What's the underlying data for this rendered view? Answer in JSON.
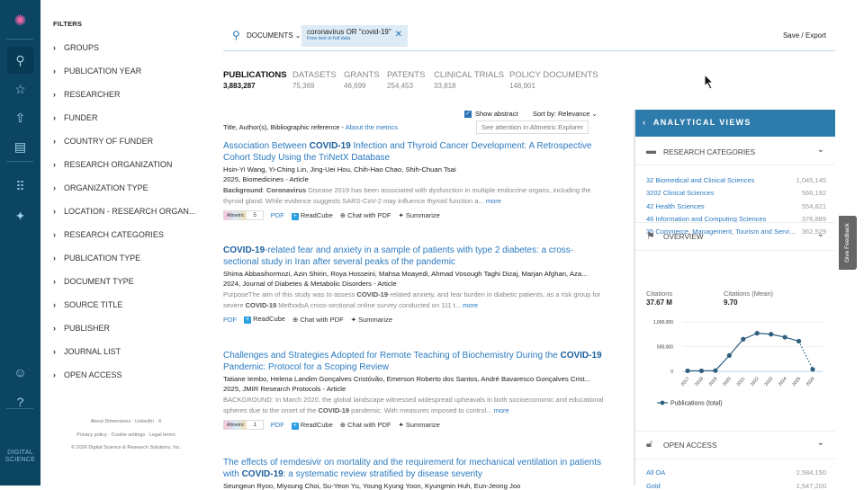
{
  "nav": {
    "items": [
      "logo-icon",
      "search-icon",
      "star-icon",
      "upload-icon",
      "document-search-icon",
      "apps-grid-icon",
      "sparkle-icon",
      "user-icon",
      "help-icon"
    ],
    "brand": "DIGITAL SCIENCE"
  },
  "filters": {
    "title": "FILTERS",
    "items": [
      "GROUPS",
      "PUBLICATION YEAR",
      "RESEARCHER",
      "FUNDER",
      "COUNTRY OF FUNDER",
      "RESEARCH ORGANIZATION",
      "ORGANIZATION TYPE",
      "LOCATION - RESEARCH ORGAN...",
      "RESEARCH CATEGORIES",
      "PUBLICATION TYPE",
      "DOCUMENT TYPE",
      "SOURCE TITLE",
      "PUBLISHER",
      "JOURNAL LIST",
      "OPEN ACCESS"
    ]
  },
  "footer": {
    "line1": "About Dimensions · LinkedIn · X",
    "line2": "Privacy policy · Cookie settings · Legal terms",
    "line3": "© 2026 Digital Science & Research Solutions, Inc."
  },
  "search": {
    "scope": "DOCUMENTS",
    "query": "coronavirus OR \"covid-19\"",
    "query_sub": "Free text in full data",
    "save_export": "Save / Export"
  },
  "tabs": [
    {
      "label": "PUBLICATIONS",
      "count": "3,883,287"
    },
    {
      "label": "DATASETS",
      "count": "75,369"
    },
    {
      "label": "GRANTS",
      "count": "46,699"
    },
    {
      "label": "PATENTS",
      "count": "254,453"
    },
    {
      "label": "CLINICAL TRIALS",
      "count": "33,818"
    },
    {
      "label": "POLICY DOCUMENTS",
      "count": "148,901"
    }
  ],
  "controls": {
    "show_abstract": "Show abstract",
    "sort_label": "Sort by:",
    "sort_value": "Relevance",
    "columns": "Title, Author(s), Bibliographic reference - ",
    "about_metrics": "About the metrics",
    "altmetric_explorer": "See attention in  Altmetric Explorer"
  },
  "actions": {
    "pdf": "PDF",
    "readcube": "ReadCube",
    "chat": "Chat with PDF",
    "summarize": "Summarize",
    "more": "more",
    "altmetric": "Altmetric"
  },
  "results": [
    {
      "title": [
        {
          "t": "Association Between "
        },
        {
          "t": "COVID-19",
          "b": 1
        },
        {
          "t": " Infection and Thyroid Cancer Development: A Retrospective Cohort Study Using the TriNetX Database"
        }
      ],
      "authors": "Hsin-Yi Wang, Yi-Ching Lin, Jing-Uei Hou, Chih-Hao Chao, Shih-Chuan Tsai",
      "journal": "2025, Biomedicines - Article",
      "abstract": [
        {
          "t": "Background",
          "b": 1
        },
        {
          "t": ": "
        },
        {
          "t": "Coronavirus",
          "b": 1
        },
        {
          "t": " Disease 2019 has been associated with dysfunction in multiple endocrine organs, including the thyroid gland. While evidence suggests SARS-CoV-2 may influence thyroid function a... "
        }
      ],
      "altmetric": "5"
    },
    {
      "title": [
        {
          "t": "COVID-19",
          "b": 1
        },
        {
          "t": "-related fear and anxiety in a sample of patients with type 2 diabetes: a cross-sectional study in Iran after several peaks of the pandemic"
        }
      ],
      "authors": "Shima Abbasihormozi, Azin Shirin, Roya Hosseini, Mahsa Moayedi, Ahmad Vosough Taghi Dizaj, Marjan Afghan, Aza...",
      "journal": "2024, Journal of Diabetes & Metabolic Disorders - Article",
      "abstract": [
        {
          "t": "PurposeThe aim of this study was to assess "
        },
        {
          "t": "COVID-19",
          "b": 1
        },
        {
          "t": "-related anxiety, and fear burden in diabetic patients, as a risk group for severe "
        },
        {
          "t": "COVID-19",
          "b": 1
        },
        {
          "t": ".MethodsA cross-sectional online survey conducted on 111 t... "
        }
      ],
      "altmetric": null
    },
    {
      "title": [
        {
          "t": "Challenges and Strategies Adopted for Remote Teaching of Biochemistry During the "
        },
        {
          "t": "COVID-19",
          "b": 1
        },
        {
          "t": " Pandemic: Protocol for a Scoping Review"
        }
      ],
      "authors": "Tatiane Iembo, Helena Landim Gonçalves Cristóvão, Emerson Roberto dos Santos, André Bavaresco Gonçalves Crist...",
      "journal": "2025, JMIR Research Protocols - Article",
      "abstract": [
        {
          "t": "BACKGROUND: In March 2020, the global landscape witnessed widespread upheavals in both socioeconomic and educational spheres due to the onset of the "
        },
        {
          "t": "COVID-19",
          "b": 1
        },
        {
          "t": " pandemic. With measures imposed to control... "
        }
      ],
      "altmetric": "1"
    },
    {
      "title": [
        {
          "t": "The effects of remdesivir on mortality and the requirement for mechanical ventilation in patients with "
        },
        {
          "t": "COVID-19",
          "b": 1
        },
        {
          "t": ": a systematic review stratified by disease severity"
        }
      ],
      "authors": "Seungeun Ryoo, Miyoung Choi, Su-Yeon Yu, Young Kyung Yoon, Kyungmin Huh, Eun-Jeong Joo",
      "journal": "",
      "abstract": [],
      "altmetric": null
    }
  ],
  "panel": {
    "title": "ANALYTICAL VIEWS",
    "research_categories": "RESEARCH CATEGORIES",
    "categories": [
      {
        "label": "32 Biomedical and Clinical Sciences",
        "value": "1,045,145"
      },
      {
        "label": "3202 Clinical Sciences",
        "value": "566,192"
      },
      {
        "label": "42 Health Sciences",
        "value": "554,821"
      },
      {
        "label": "46 Information and Computing Sciences",
        "value": "376,889"
      },
      {
        "label": "35 Commerce, Management, Tourism and Services",
        "value": "362,529"
      }
    ],
    "overview": "OVERVIEW",
    "citations_label": "Citations",
    "citations": "37.67 M",
    "mean_label": "Citations (Mean)",
    "mean": "9.70",
    "open_access": "OPEN ACCESS",
    "oa": [
      {
        "label": "All OA",
        "value": "2,584,150"
      },
      {
        "label": "Gold",
        "value": "1,547,200"
      }
    ],
    "feedback": "Give Feedback"
  },
  "chart_data": {
    "type": "line",
    "x": [
      "2017",
      "2018",
      "2019",
      "2020",
      "2021",
      "2022",
      "2023",
      "2024",
      "2025",
      "2026"
    ],
    "series": [
      {
        "name": "Publications (total)",
        "values": [
          10000,
          10000,
          15000,
          320000,
          650000,
          770000,
          750000,
          690000,
          610000,
          40000
        ]
      }
    ],
    "yticks": [
      "0",
      "500,000",
      "1,000,000"
    ],
    "ylim": [
      0,
      1000000
    ],
    "legend": "bottom",
    "color": "#2e5f7f"
  }
}
